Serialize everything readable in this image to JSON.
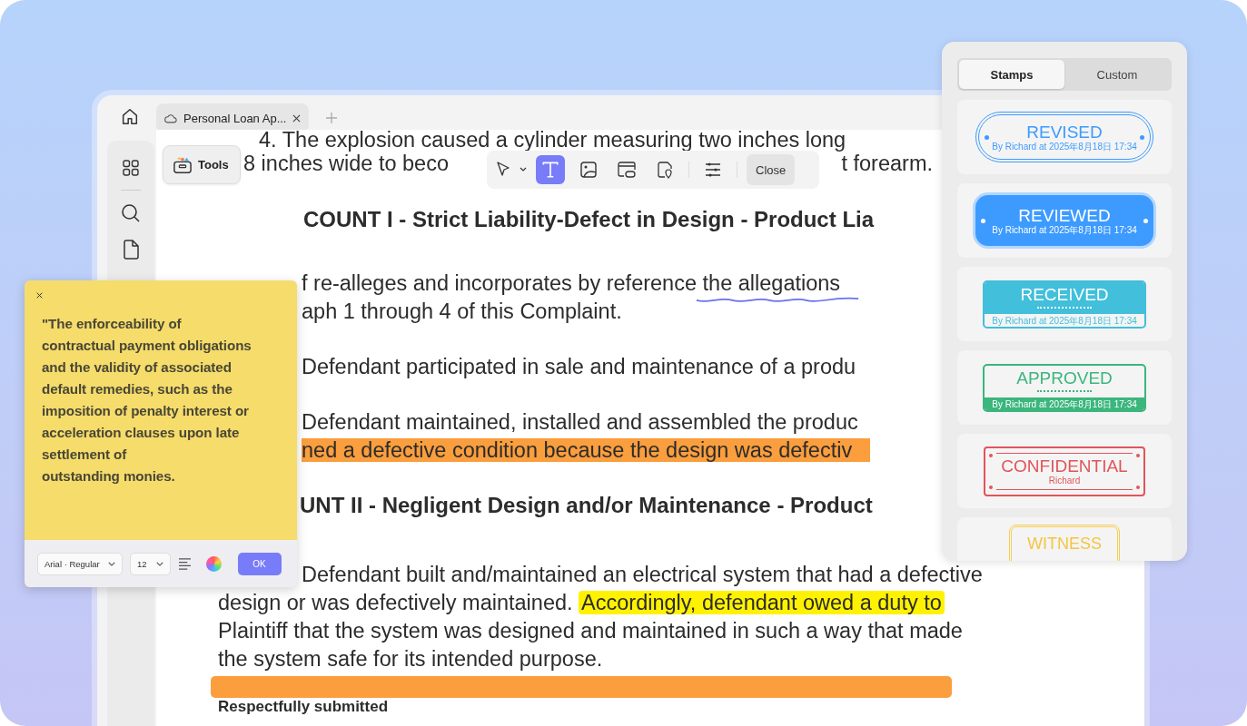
{
  "tabs": [
    {
      "title": "Personal Loan Ap...",
      "selected": true
    }
  ],
  "tools_button": {
    "label": "Tools"
  },
  "toolbar": {
    "tools": [
      {
        "kind": "select",
        "selected": false
      },
      {
        "kind": "text",
        "selected": true
      },
      {
        "kind": "image",
        "selected": false
      },
      {
        "kind": "link",
        "selected": false
      },
      {
        "kind": "location",
        "selected": false
      },
      {
        "kind": "settings",
        "selected": false
      }
    ],
    "close": "Close"
  },
  "document": {
    "lines": [
      {
        "kind": "item",
        "segments": [
          {
            "text": "4.  The explosion caused a cylinder measuring two inches long"
          }
        ]
      },
      {
        "kind": "split",
        "segments": [
          {
            "text": "8 inches wide to beco"
          },
          {
            "text": "t forearm."
          }
        ]
      },
      {
        "kind": "heading",
        "segments": [
          {
            "text": "COUNT I - Strict Liability-Defect in Design - Product Lia"
          }
        ]
      },
      {
        "kind": "covered",
        "segments": [
          {
            "text": "f re-alleges and incorporates by reference "
          },
          {
            "text": "the allegations",
            "kind": "wavy-underline"
          }
        ]
      },
      {
        "kind": "covered-cont",
        "segments": [
          {
            "text": "aph 1 through 4 of this Complaint."
          }
        ]
      },
      {
        "kind": "covered",
        "segments": [
          {
            "text": "Defendant participated in sale and maintenance of a produ"
          }
        ]
      },
      {
        "kind": "covered",
        "segments": [
          {
            "text": "Defendant maintained, installed and assembled the produc"
          }
        ]
      },
      {
        "kind": "covered-cont",
        "segments": [
          {
            "text": "ned a defective condition because the design was defectiv",
            "kind": "orange-highlight"
          }
        ]
      },
      {
        "kind": "heading-covered",
        "segments": [
          {
            "text": "UNT II - Negligent Design and/or Maintenance - Product"
          }
        ]
      },
      {
        "kind": "covered",
        "segments": [
          {
            "text": "Defendant built and/maintained an electrical system that had a defective"
          }
        ]
      },
      {
        "kind": "body-cont",
        "segments": [
          {
            "text": "design or was defectively maintained. "
          },
          {
            "text": "Accordingly, defendant owed a duty to",
            "kind": "yellow-highlight"
          }
        ]
      },
      {
        "kind": "body-cont",
        "segments": [
          {
            "text": "Plaintiff that the system was designed and maintained in such a way that made"
          }
        ]
      },
      {
        "kind": "body-cont",
        "segments": [
          {
            "text": "the system safe for its intended purpose."
          }
        ]
      },
      {
        "kind": "bar"
      },
      {
        "kind": "closing",
        "segments": [
          {
            "text": "Respectfully submitted"
          }
        ]
      }
    ]
  },
  "stamp_panel": {
    "tabs": [
      {
        "label": "Stamps",
        "selected": true
      },
      {
        "label": "Custom",
        "selected": false
      }
    ],
    "stamps": [
      {
        "kind": "outline-pill",
        "title": "REVISED",
        "caption": "By Richard at 2025年8月18日 17:34",
        "color": "#3d9bff"
      },
      {
        "kind": "filled-pill",
        "title": "REVIEWED",
        "caption": "By Richard at 2025年8月18日 17:34",
        "color": "#3d9bff"
      },
      {
        "kind": "top-filled",
        "title": "RECEIVED",
        "caption": "By Richard at 2025年8月18日 17:34",
        "color": "#41bfdb"
      },
      {
        "kind": "bottom-filled",
        "title": "APPROVED",
        "caption": "By Richard at 2025年8月18日 17:34",
        "color": "#3bb67d"
      },
      {
        "kind": "framed",
        "title": "CONFIDENTIAL",
        "caption": "Richard",
        "color": "#e0555a"
      },
      {
        "kind": "flag",
        "title": "WITNESS",
        "color": "#f7cf55"
      }
    ]
  },
  "note": {
    "lines": [
      "\"The enforceability of",
      "contractual payment obligations",
      "and the validity of associated",
      "default remedies, such as the",
      "imposition of penalty interest or",
      "acceleration clauses upon late",
      "settlement of",
      "outstanding monies."
    ],
    "font": "Arial · Regular",
    "size": "12",
    "ok": "OK"
  }
}
